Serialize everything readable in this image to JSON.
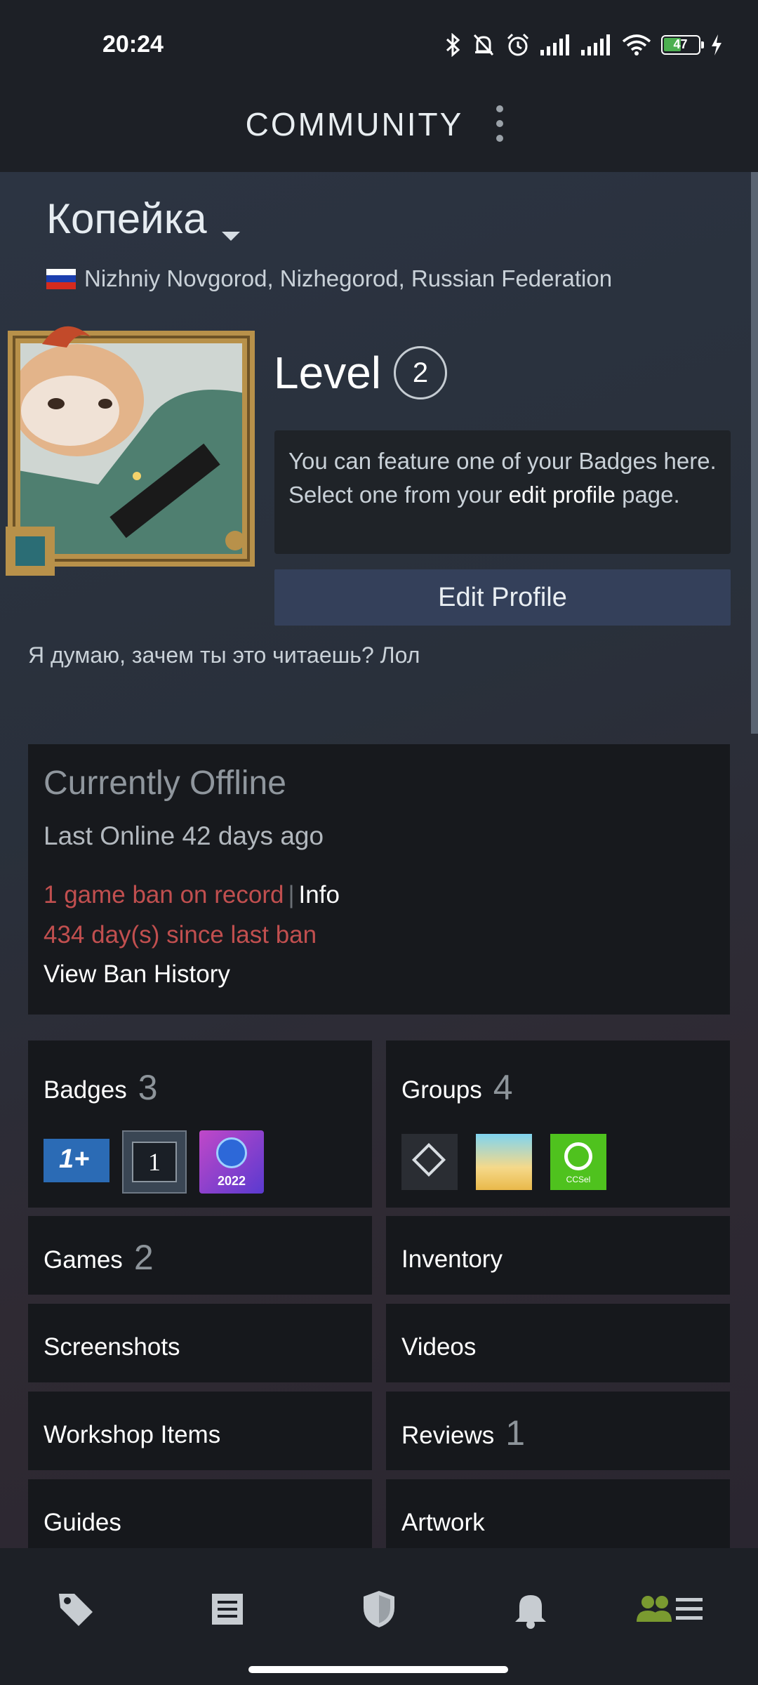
{
  "status_bar": {
    "time": "20:24",
    "battery": "47"
  },
  "app_bar": {
    "title": "COMMUNITY"
  },
  "profile": {
    "name": "Копейка",
    "location": "Nizhniy Novgorod, Nizhegorod, Russian Federation",
    "level_label": "Level",
    "level_value": "2",
    "badge_note_part1": "You can feature one of your Badges here. Select one from your",
    "badge_note_link": "edit profile",
    "badge_note_part2": "page.",
    "edit_button": "Edit Profile",
    "summary": "Я думаю, зачем ты это читаешь? Лол"
  },
  "status_panel": {
    "title": "Currently Offline",
    "last_online": "Last Online 42 days ago",
    "ban_record": "1 game ban on record",
    "ban_separator": "|",
    "ban_info": "Info",
    "days_since_ban": "434 day(s) since last ban",
    "view_history": "View Ban History"
  },
  "tiles": {
    "badges": {
      "label": "Badges",
      "count": "3",
      "icons": [
        "1+",
        "1",
        "2022"
      ]
    },
    "groups": {
      "label": "Groups",
      "count": "4",
      "icons": [
        "CCSel"
      ]
    },
    "games": {
      "label": "Games",
      "count": "2"
    },
    "inventory": {
      "label": "Inventory"
    },
    "screenshots": {
      "label": "Screenshots"
    },
    "videos": {
      "label": "Videos"
    },
    "workshop": {
      "label": "Workshop Items"
    },
    "reviews": {
      "label": "Reviews",
      "count": "1"
    },
    "guides": {
      "label": "Guides"
    },
    "artwork": {
      "label": "Artwork"
    }
  },
  "bottom_nav": {
    "items": [
      "tag-icon",
      "news-icon",
      "shield-icon",
      "bell-icon",
      "friends-icon"
    ],
    "active": "friends-icon",
    "active_color": "#7a9a30"
  },
  "colors": {
    "ban_red": "#c14f4f",
    "button_blue": "#34405a",
    "background": "#16191f"
  }
}
